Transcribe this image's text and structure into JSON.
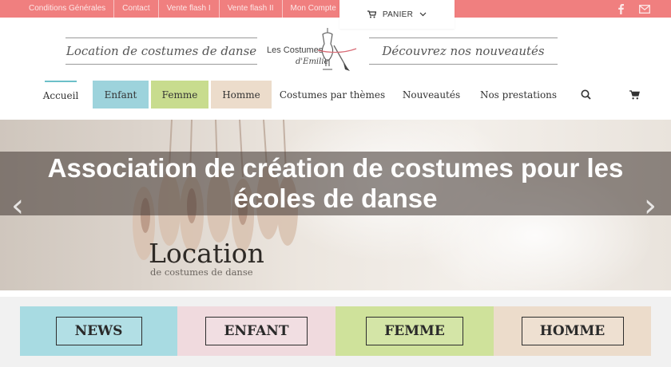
{
  "topbar": {
    "links": [
      "Conditions Générales",
      "Contact",
      "Vente flash I",
      "Vente flash II",
      "Mon Compte"
    ],
    "cart_label": "PANIER"
  },
  "banner": {
    "left_text": "Location de costumes de danse",
    "right_text": "Découvrez nos nouveautés",
    "logo_line1": "Les Costumes",
    "logo_line2": "d'Emilie"
  },
  "nav": {
    "items": [
      "Accueil",
      "Enfant",
      "Femme",
      "Homme",
      "Costumes par thèmes",
      "Nouveautés",
      "Nos prestations"
    ]
  },
  "hero": {
    "title": "Association de création de costumes pour les écoles de danse",
    "caption_big": "Location",
    "caption_small": "de costumes de danse"
  },
  "categories": [
    "NEWS",
    "ENFANT",
    "FEMME",
    "HOMME"
  ],
  "colors": {
    "topbar": "#f07f7f",
    "enfant": "#9dd3dc",
    "femme": "#c8dc8e",
    "homme": "#ecdccb",
    "news_tile": "#a8dbe2",
    "enfant_tile": "#f0dade",
    "femme_tile": "#cfe29b",
    "homme_tile": "#ecdccb"
  },
  "icons": [
    "cart-icon",
    "chevron-down-icon",
    "facebook-icon",
    "mail-icon",
    "search-icon",
    "arrow-left-icon",
    "arrow-right-icon",
    "mannequin-icon"
  ]
}
